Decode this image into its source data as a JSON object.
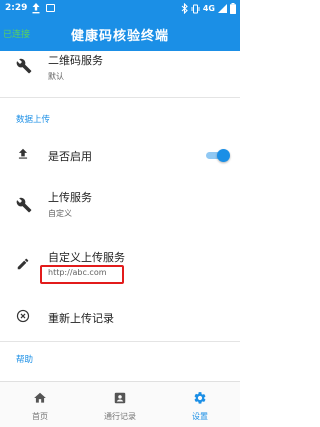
{
  "status_bar": {
    "time": "2:29",
    "network": "4G"
  },
  "app_bar": {
    "left_label": "已连接",
    "title": "健康码核验终端"
  },
  "list": {
    "qr_service": {
      "title": "二维码服务",
      "subtitle": "默认",
      "icon": "wrench-icon"
    },
    "section_upload": "数据上传",
    "enable": {
      "title": "是否启用",
      "icon": "upload-icon",
      "toggle_on": true
    },
    "upload_service": {
      "title": "上传服务",
      "subtitle": "自定义",
      "icon": "wrench-icon"
    },
    "custom_service": {
      "title": "自定义上传服务",
      "subtitle": "http://abc.com",
      "icon": "pencil-icon"
    },
    "reupload": {
      "title": "重新上传记录",
      "icon": "cancel-circle-icon"
    },
    "section_help": "帮助"
  },
  "bottom_nav": {
    "tabs": [
      {
        "label": "首页",
        "icon": "home-icon",
        "active": false
      },
      {
        "label": "通行记录",
        "icon": "id-card-icon",
        "active": false
      },
      {
        "label": "设置",
        "icon": "gear-icon",
        "active": true
      }
    ]
  },
  "colors": {
    "primary": "#1b8fe6",
    "highlight_box": "#e21b1b",
    "connected": "#58d15f"
  }
}
